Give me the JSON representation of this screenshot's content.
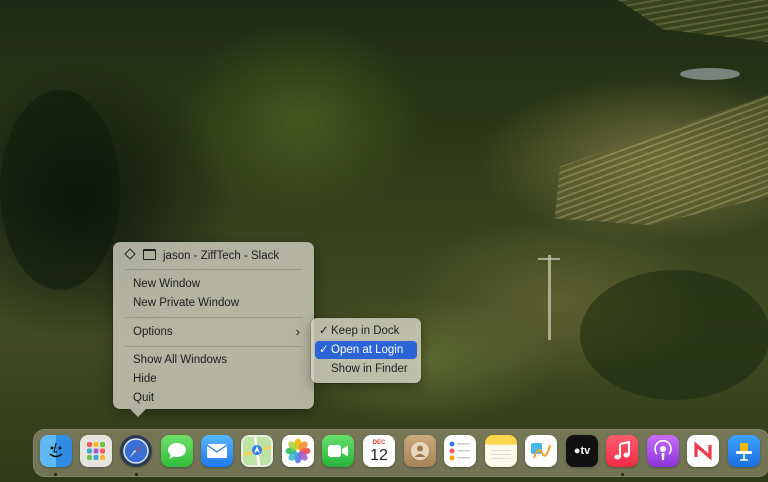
{
  "context_menu": {
    "window_item": "jason - ZiffTech - Slack",
    "new_window": "New Window",
    "new_private_window": "New Private Window",
    "options": "Options",
    "options_chevron": "›",
    "show_all_windows": "Show All Windows",
    "hide": "Hide",
    "quit": "Quit"
  },
  "options_submenu": {
    "keep_in_dock": "Keep in Dock",
    "keep_in_dock_checked": true,
    "open_at_login": "Open at Login",
    "open_at_login_checked": true,
    "open_at_login_highlighted": true,
    "show_in_finder": "Show in Finder",
    "check_glyph": "✓"
  },
  "dock": {
    "apps": [
      {
        "name": "Finder",
        "icon": "finder-icon",
        "running": true
      },
      {
        "name": "Launchpad",
        "icon": "launchpad-icon",
        "running": false
      },
      {
        "name": "Safari",
        "icon": "safari-icon",
        "running": true
      },
      {
        "name": "Messages",
        "icon": "messages-icon",
        "running": false
      },
      {
        "name": "Mail",
        "icon": "mail-icon",
        "running": false
      },
      {
        "name": "Maps",
        "icon": "maps-icon",
        "running": false
      },
      {
        "name": "Photos",
        "icon": "photos-icon",
        "running": false
      },
      {
        "name": "FaceTime",
        "icon": "facetime-icon",
        "running": false
      },
      {
        "name": "Calendar",
        "icon": "calendar-icon",
        "running": false,
        "month": "DEC",
        "day": "12"
      },
      {
        "name": "Contacts",
        "icon": "contacts-icon",
        "running": false
      },
      {
        "name": "Reminders",
        "icon": "reminders-icon",
        "running": false
      },
      {
        "name": "Notes",
        "icon": "notes-icon",
        "running": false
      },
      {
        "name": "Freeform",
        "icon": "freeform-icon",
        "running": false
      },
      {
        "name": "TV",
        "icon": "tv-icon",
        "running": false,
        "label": "tv"
      },
      {
        "name": "Music",
        "icon": "music-icon",
        "running": true
      },
      {
        "name": "Podcasts",
        "icon": "podcasts-icon",
        "running": false
      },
      {
        "name": "News",
        "icon": "news-icon",
        "running": false
      },
      {
        "name": "Keynote",
        "icon": "keynote-icon",
        "running": false
      }
    ]
  },
  "colors": {
    "highlight": "#2c63d6",
    "menu_bg": "#d6d4c4"
  }
}
